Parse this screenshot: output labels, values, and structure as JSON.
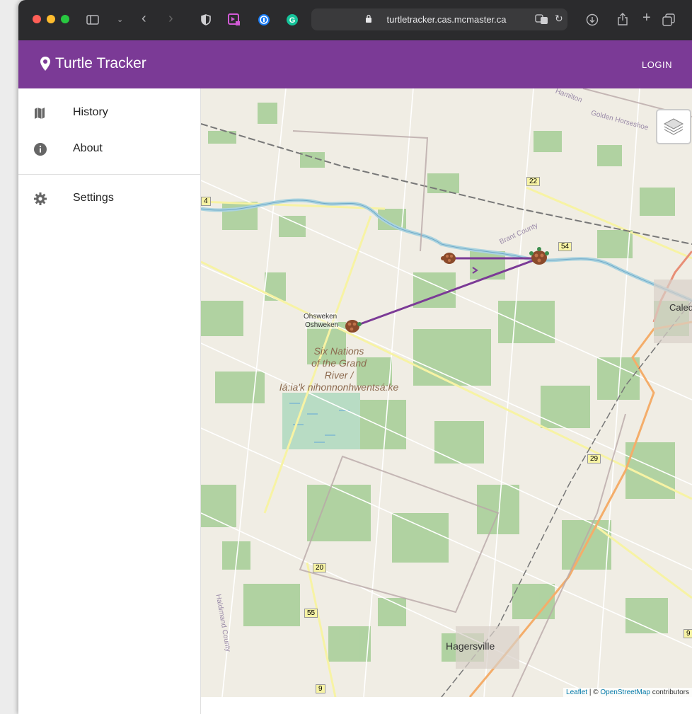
{
  "browser": {
    "url": "turtletracker.cas.mcmaster.ca",
    "traffic_lights": [
      "#ff5f57",
      "#febc2e",
      "#28c840"
    ]
  },
  "app": {
    "title": "Turtle Tracker",
    "login_label": "LOGIN",
    "brand_color": "#7b3a96"
  },
  "sidebar": {
    "items": [
      {
        "label": "History",
        "icon": "map-icon"
      },
      {
        "label": "About",
        "icon": "info-icon"
      },
      {
        "label": "Settings",
        "icon": "gear-icon"
      }
    ]
  },
  "map": {
    "labels": {
      "place_ohsweken": "Ohsweken",
      "place_oshweken": "Oshweken",
      "reserve_line1": "Six Nations",
      "reserve_line2": "of the Grand",
      "reserve_line3": "River /",
      "reserve_line4": "Iá:ia'k nihonnonhwentsá:ke",
      "town_hagersville": "Hagersville",
      "town_caledonia": "Caled",
      "road_22": "22",
      "road_54": "54",
      "road_29": "29",
      "road_20": "20",
      "road_55": "55",
      "road_9": "9",
      "road_9b": "9",
      "road_4": "4",
      "brant_county": "Brant County",
      "haldimand_county": "Haldimand County",
      "hamilton": "Hamilton",
      "golden_horseshoe": "Golden Horseshoe"
    },
    "track_color": "#7b3a96",
    "attribution": {
      "leaflet": "Leaflet",
      "separator": " | © ",
      "osm": "OpenStreetMap",
      "suffix": " contributors"
    }
  }
}
